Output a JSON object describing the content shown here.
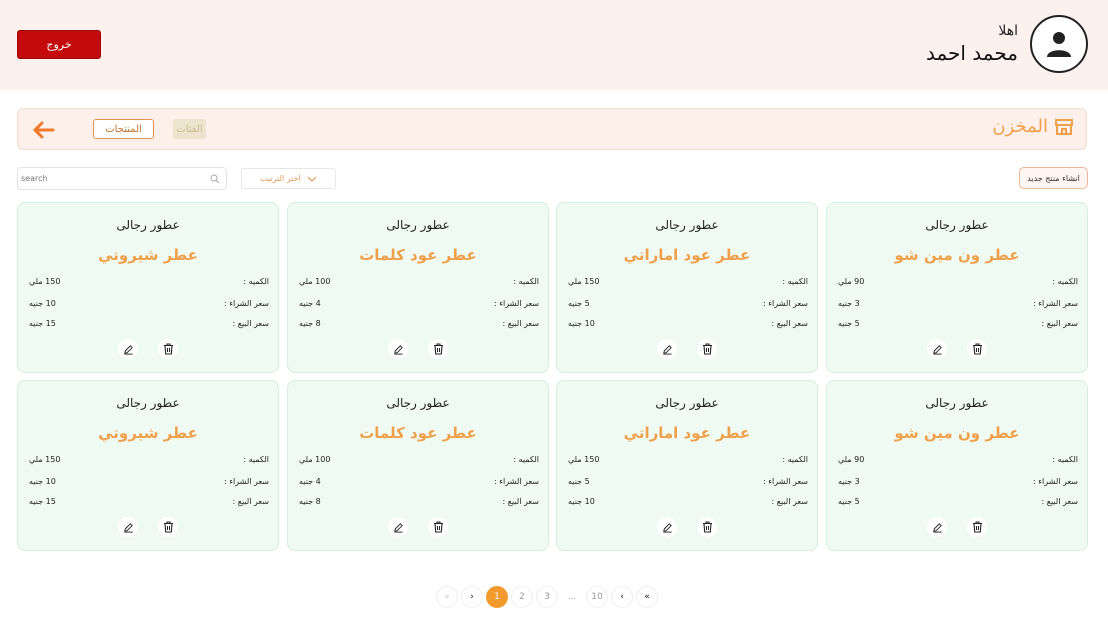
{
  "header": {
    "greeting": "اهلا",
    "username": "محمد احمد",
    "logout_label": "خروج"
  },
  "section": {
    "title": "المخزن",
    "tabs": [
      {
        "label": "المنتجات",
        "active": true
      },
      {
        "label": "الفئات",
        "active": false
      }
    ]
  },
  "toolbar": {
    "create_label": "انشاء منتج جديد",
    "sort_label": "اختر الترتيب",
    "search_placeholder": "search"
  },
  "labels": {
    "quantity": "الكميه :",
    "buy_price": "سعر الشراء :",
    "sell_price": "سعر البيع :"
  },
  "products": [
    {
      "category": "عطور رجالى",
      "name": "عطر ون مين شو",
      "quantity": "90 ملي",
      "buy": "3 جنيه",
      "sell": "5 جنيه"
    },
    {
      "category": "عطور رجالى",
      "name": "عطر عود اماراتي",
      "quantity": "150 ملي",
      "buy": "5 جنيه",
      "sell": "10 جنيه"
    },
    {
      "category": "عطور رجالى",
      "name": "عطر عود كلمات",
      "quantity": "100 ملي",
      "buy": "4 جنيه",
      "sell": "8 جنيه"
    },
    {
      "category": "عطور رجالى",
      "name": "عطر شيروتي",
      "quantity": "150 ملي",
      "buy": "10 جنيه",
      "sell": "15 جنيه"
    },
    {
      "category": "عطور رجالى",
      "name": "عطر ون مين شو",
      "quantity": "90 ملي",
      "buy": "3 جنيه",
      "sell": "5 جنيه"
    },
    {
      "category": "عطور رجالى",
      "name": "عطر عود اماراتي",
      "quantity": "150 ملي",
      "buy": "5 جنيه",
      "sell": "10 جنيه"
    },
    {
      "category": "عطور رجالى",
      "name": "عطر عود كلمات",
      "quantity": "100 ملي",
      "buy": "4 جنيه",
      "sell": "8 جنيه"
    },
    {
      "category": "عطور رجالى",
      "name": "عطر شيروتي",
      "quantity": "150 ملي",
      "buy": "10 جنيه",
      "sell": "15 جنيه"
    }
  ],
  "pagination": {
    "first": "«",
    "next": "›",
    "pages": [
      "1",
      "2",
      "3"
    ],
    "ellipsis": "...",
    "last_page": "10",
    "prev": "‹",
    "last": "»",
    "current": "1"
  },
  "colors": {
    "accent": "#f0a04b",
    "logout": "#c40a0a",
    "header_bg": "#fdf1ee",
    "card_bg": "#effaf3",
    "active_page": "#f39a2e"
  }
}
